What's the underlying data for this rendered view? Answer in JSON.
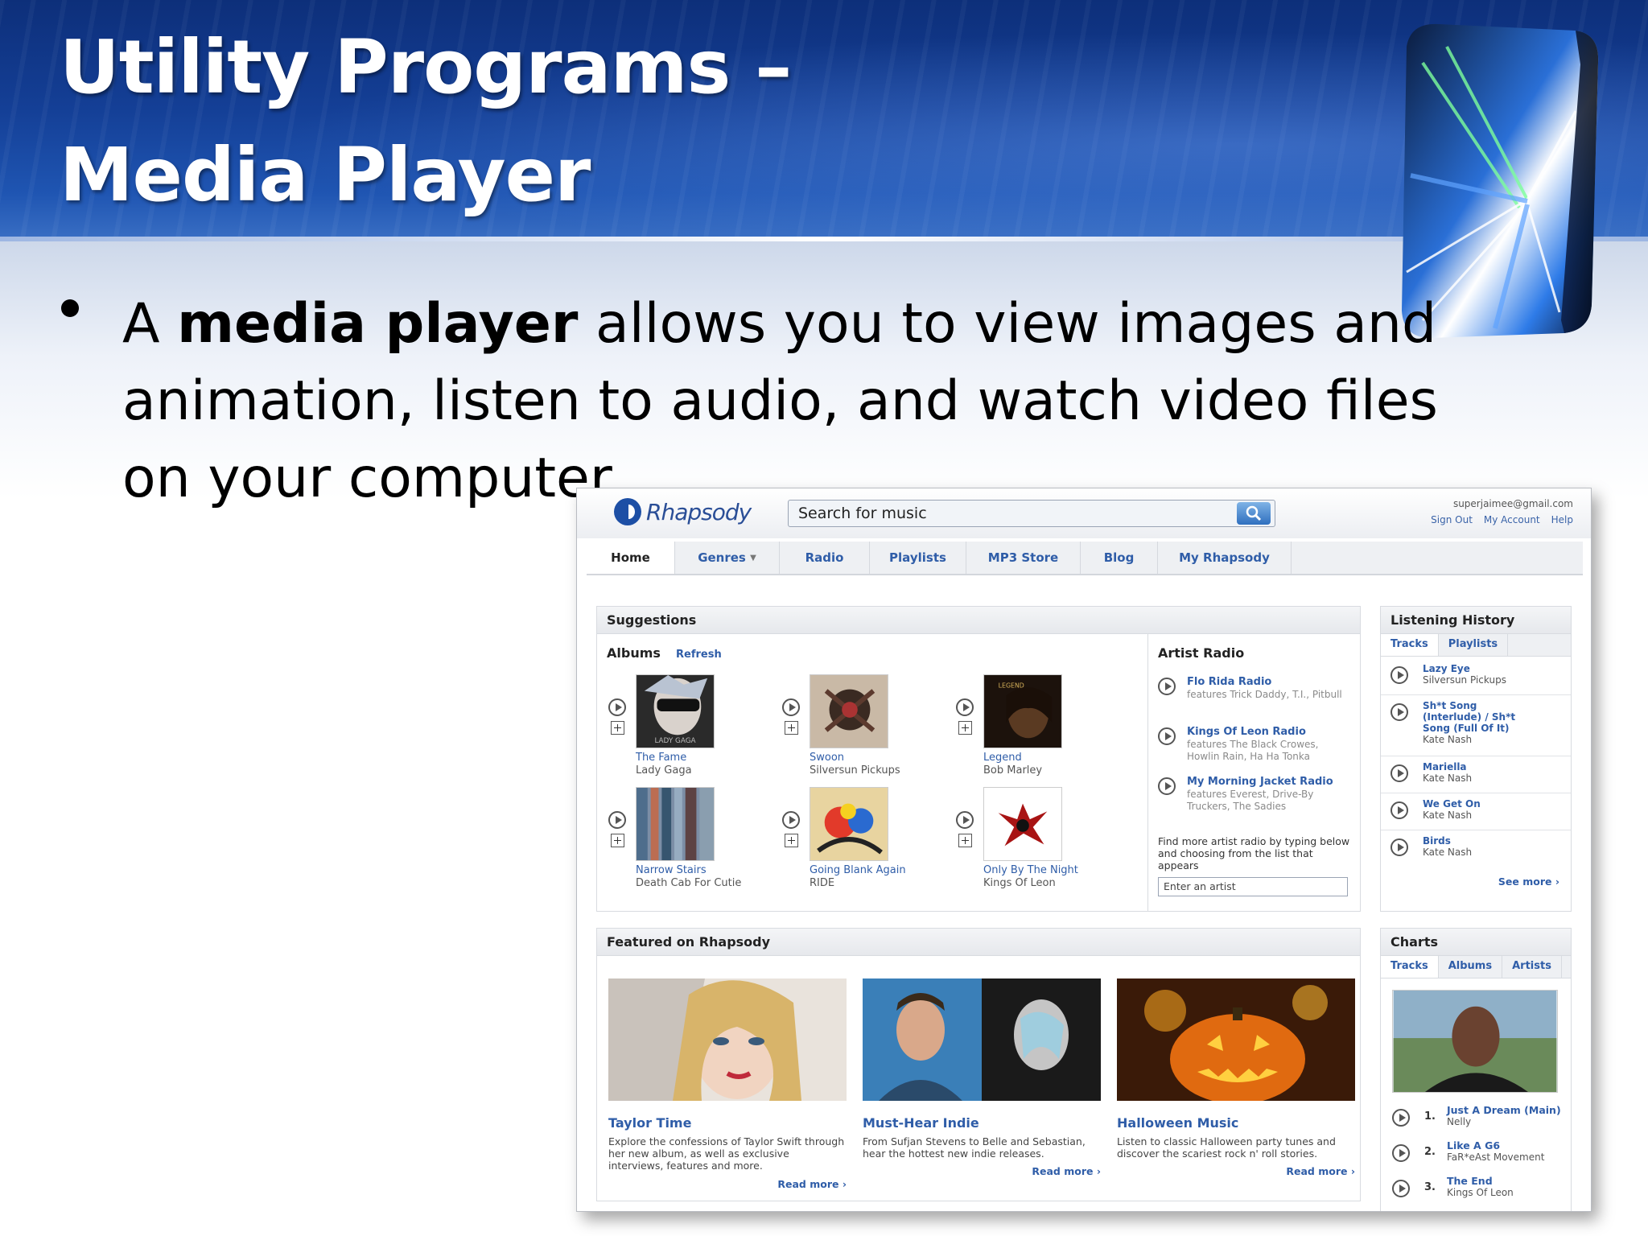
{
  "slide": {
    "title_line1": "Utility Programs –",
    "title_line2": "Media Player",
    "bullet_pre": "A ",
    "bullet_bold": "media player",
    "bullet_post": " allows you to view images and animation, listen to audio, and watch video files on your computer."
  },
  "app": {
    "logo_text": "Rhapsody",
    "search_placeholder": "Search for music",
    "account_email": "superjaimee@gmail.com",
    "account_links": [
      "Sign Out",
      "My Account",
      "Help"
    ],
    "nav_tabs": [
      "Home",
      "Genres",
      "Radio",
      "Playlists",
      "MP3 Store",
      "Blog",
      "My Rhapsody"
    ]
  },
  "suggestions": {
    "header": "Suggestions",
    "albums_label": "Albums",
    "refresh_label": "Refresh",
    "albums": [
      {
        "title": "The Fame",
        "artist": "Lady Gaga"
      },
      {
        "title": "Swoon",
        "artist": "Silversun Pickups"
      },
      {
        "title": "Legend",
        "artist": "Bob Marley"
      },
      {
        "title": "Narrow Stairs",
        "artist": "Death Cab For Cutie"
      },
      {
        "title": "Going Blank Again",
        "artist": "RIDE"
      },
      {
        "title": "Only By The Night",
        "artist": "Kings Of Leon"
      }
    ]
  },
  "artist_radio": {
    "header": "Artist Radio",
    "items": [
      {
        "name": "Flo Rida Radio",
        "desc": "features Trick Daddy, T.I., Pitbull"
      },
      {
        "name": "Kings Of Leon Radio",
        "desc": "features The Black Crowes, Howlin Rain, Ha Ha Tonka"
      },
      {
        "name": "My Morning Jacket Radio",
        "desc": "features Everest, Drive-By Truckers, The Sadies"
      }
    ],
    "find_more": "Find more artist radio by typing below and choosing from the list that appears",
    "input_placeholder": "Enter an artist"
  },
  "history": {
    "header": "Listening History",
    "tabs": [
      "Tracks",
      "Playlists"
    ],
    "items": [
      {
        "track": "Lazy Eye",
        "artist": "Silversun Pickups"
      },
      {
        "track": "Sh*t Song (Interlude) / Sh*t Song (Full Of It)",
        "artist": "Kate Nash"
      },
      {
        "track": "Mariella",
        "artist": "Kate Nash"
      },
      {
        "track": "We Get On",
        "artist": "Kate Nash"
      },
      {
        "track": "Birds",
        "artist": "Kate Nash"
      }
    ],
    "see_more": "See more ›"
  },
  "featured": {
    "header": "Featured on Rhapsody",
    "items": [
      {
        "title": "Taylor Time",
        "desc": "Explore the confessions of Taylor Swift through her new album, as well as exclusive interviews, features and more.",
        "more": "Read more ›"
      },
      {
        "title": "Must-Hear Indie",
        "desc": "From Sufjan Stevens to Belle and Sebastian, hear the hottest new indie releases.",
        "more": "Read more ›"
      },
      {
        "title": "Halloween Music",
        "desc": "Listen to classic Halloween party tunes and discover the scariest rock n' roll stories.",
        "more": "Read more ›"
      }
    ]
  },
  "charts": {
    "header": "Charts",
    "tabs": [
      "Tracks",
      "Albums",
      "Artists"
    ],
    "items": [
      {
        "rank": "1.",
        "title": "Just A Dream (Main)",
        "artist": "Nelly"
      },
      {
        "rank": "2.",
        "title": "Like A G6",
        "artist": "FaR*eAst Movement"
      },
      {
        "rank": "3.",
        "title": "The End",
        "artist": "Kings Of Leon"
      }
    ]
  }
}
